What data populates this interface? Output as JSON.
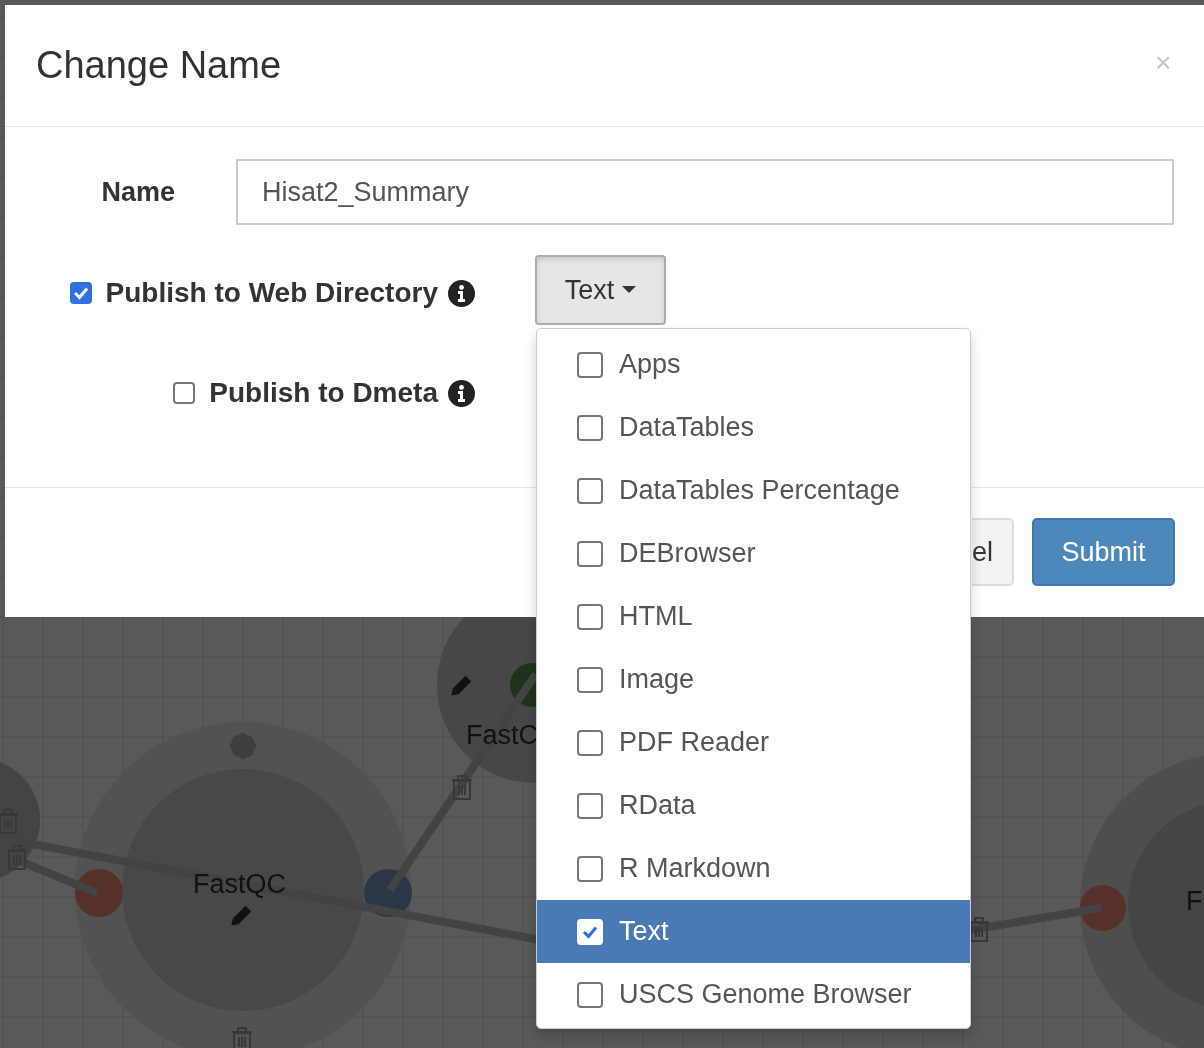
{
  "canvas": {
    "node_labels": [
      "FastQC",
      "FastC",
      "F"
    ]
  },
  "modal": {
    "title": "Change Name",
    "close": "×",
    "name_label": "Name",
    "name_value": "Hisat2_Summary",
    "options": [
      {
        "label": "Publish to Web Directory",
        "checked": true
      },
      {
        "label": "Publish to Dmeta",
        "checked": false
      }
    ],
    "type_button": "Text",
    "type_menu": [
      {
        "label": "Apps",
        "selected": false
      },
      {
        "label": "DataTables",
        "selected": false
      },
      {
        "label": "DataTables Percentage",
        "selected": false
      },
      {
        "label": "DEBrowser",
        "selected": false
      },
      {
        "label": "HTML",
        "selected": false
      },
      {
        "label": "Image",
        "selected": false
      },
      {
        "label": "PDF Reader",
        "selected": false
      },
      {
        "label": "RData",
        "selected": false
      },
      {
        "label": "R Markdown",
        "selected": false
      },
      {
        "label": "Text",
        "selected": true
      },
      {
        "label": "USCS Genome Browser",
        "selected": false
      }
    ],
    "cancel_button": "el",
    "submit_button": "Submit"
  }
}
